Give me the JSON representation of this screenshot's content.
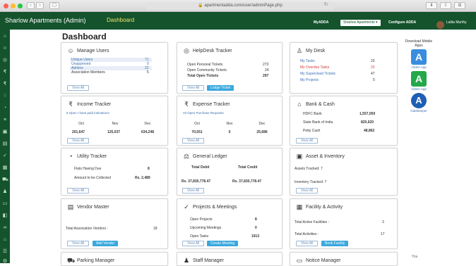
{
  "browser": {
    "url": "apartmentadda.com/user/adminPage.php"
  },
  "topbar": {
    "brand": "Sharlow Apartments (Admin)",
    "crumb": "Dashboard",
    "myadda": "MyADDA",
    "community": "Sharlow Apartments",
    "configure": "Configure ADDA",
    "user": "Lalita Murthy"
  },
  "page": {
    "title": "Dashboard"
  },
  "manage_users": {
    "title": "Manage Users",
    "rows": [
      {
        "label": "Unique Users",
        "value": "71"
      },
      {
        "label": "Unapproved",
        "value": "0"
      },
      {
        "label": "Admins",
        "value": "22"
      },
      {
        "label": "Association Members",
        "value": "5"
      }
    ],
    "view_all": "View All"
  },
  "helpdesk": {
    "title": "HelpDesk Tracker",
    "rows": [
      {
        "label": "Open Personal Tickets",
        "value": "273"
      },
      {
        "label": "Open Community Tickets",
        "value": "24"
      },
      {
        "label": "Total Open Tickets",
        "value": "297"
      }
    ],
    "view_all": "View All",
    "action": "Lodge Ticket"
  },
  "mydesk": {
    "title": "My Desk",
    "rows": [
      {
        "label": "My Tasks",
        "value": "23"
      },
      {
        "label": "My Overdue Tasks",
        "value": "23"
      },
      {
        "label": "My Supervised Tickets",
        "value": "47"
      },
      {
        "label": "My Projects",
        "value": "5"
      }
    ]
  },
  "income": {
    "title": "Income Tracker",
    "sub": "8 Open I have paid intimations",
    "months": [
      "Oct",
      "Nov",
      "Dec"
    ],
    "values": [
      "201,647",
      "125,037",
      "634,248"
    ],
    "view_all": "View All"
  },
  "expense": {
    "title": "Expense Tracker",
    "sub": "33 Open Purchase Requests",
    "months": [
      "Oct",
      "Nov",
      "Dec"
    ],
    "values": [
      "70,551",
      "0",
      "25,686"
    ],
    "view_all": "View All"
  },
  "bank": {
    "title": "Bank & Cash",
    "rows": [
      {
        "label": "HDFC Bank",
        "value": "1,557,050"
      },
      {
        "label": "State Bank of India",
        "value": "820,620"
      },
      {
        "label": "Petty Cash",
        "value": "48,862"
      }
    ],
    "view_all": "View All"
  },
  "utility": {
    "title": "Utility Tracker",
    "rows": [
      {
        "label": "Flats Having Due",
        "value": "8"
      },
      {
        "label": "Amount to be Collected",
        "value": "Rs. 2,489"
      }
    ],
    "view_all": "View All"
  },
  "ledger": {
    "title": "General Ledger",
    "debit_label": "Total Debit",
    "credit_label": "Total Credit",
    "debit": "Rs. 37,830,778.47",
    "credit": "Rs. 37,830,778.47",
    "view_all": "View All"
  },
  "asset": {
    "title": "Asset & Inventory",
    "rows": [
      "Assets Tracked: 7",
      "Inventory Tracked: 7"
    ],
    "view_all": "View All"
  },
  "vendor": {
    "title": "Vendor Master",
    "label": "Total Association Vendors :",
    "value": "18",
    "view_all": "View All",
    "action": "Add Vendor"
  },
  "projects": {
    "title": "Projects & Meetings",
    "rows": [
      {
        "label": "Open Projects",
        "value": "8"
      },
      {
        "label": "Upcoming Meetings",
        "value": "0"
      },
      {
        "label": "Open Tasks",
        "value": "1913"
      }
    ],
    "view_all": "View All",
    "action": "Create Meeting"
  },
  "facility": {
    "title": "Facility & Activity",
    "rows": [
      {
        "label": "Total Active Facilities :",
        "value": "3"
      },
      {
        "label": "Total Activities :",
        "value": "17"
      }
    ],
    "view_all": "View All",
    "action": "Book Facility"
  },
  "bottom": {
    "parking": "Parking Manager",
    "staff": "Staff Manager",
    "notice": "Notice Manager",
    "you": "You"
  },
  "apps": {
    "heading": "Download Mobile Apps",
    "adda": "ADDA App",
    "admin": "Admin App",
    "gatekeeper": "Gatekeeper"
  }
}
